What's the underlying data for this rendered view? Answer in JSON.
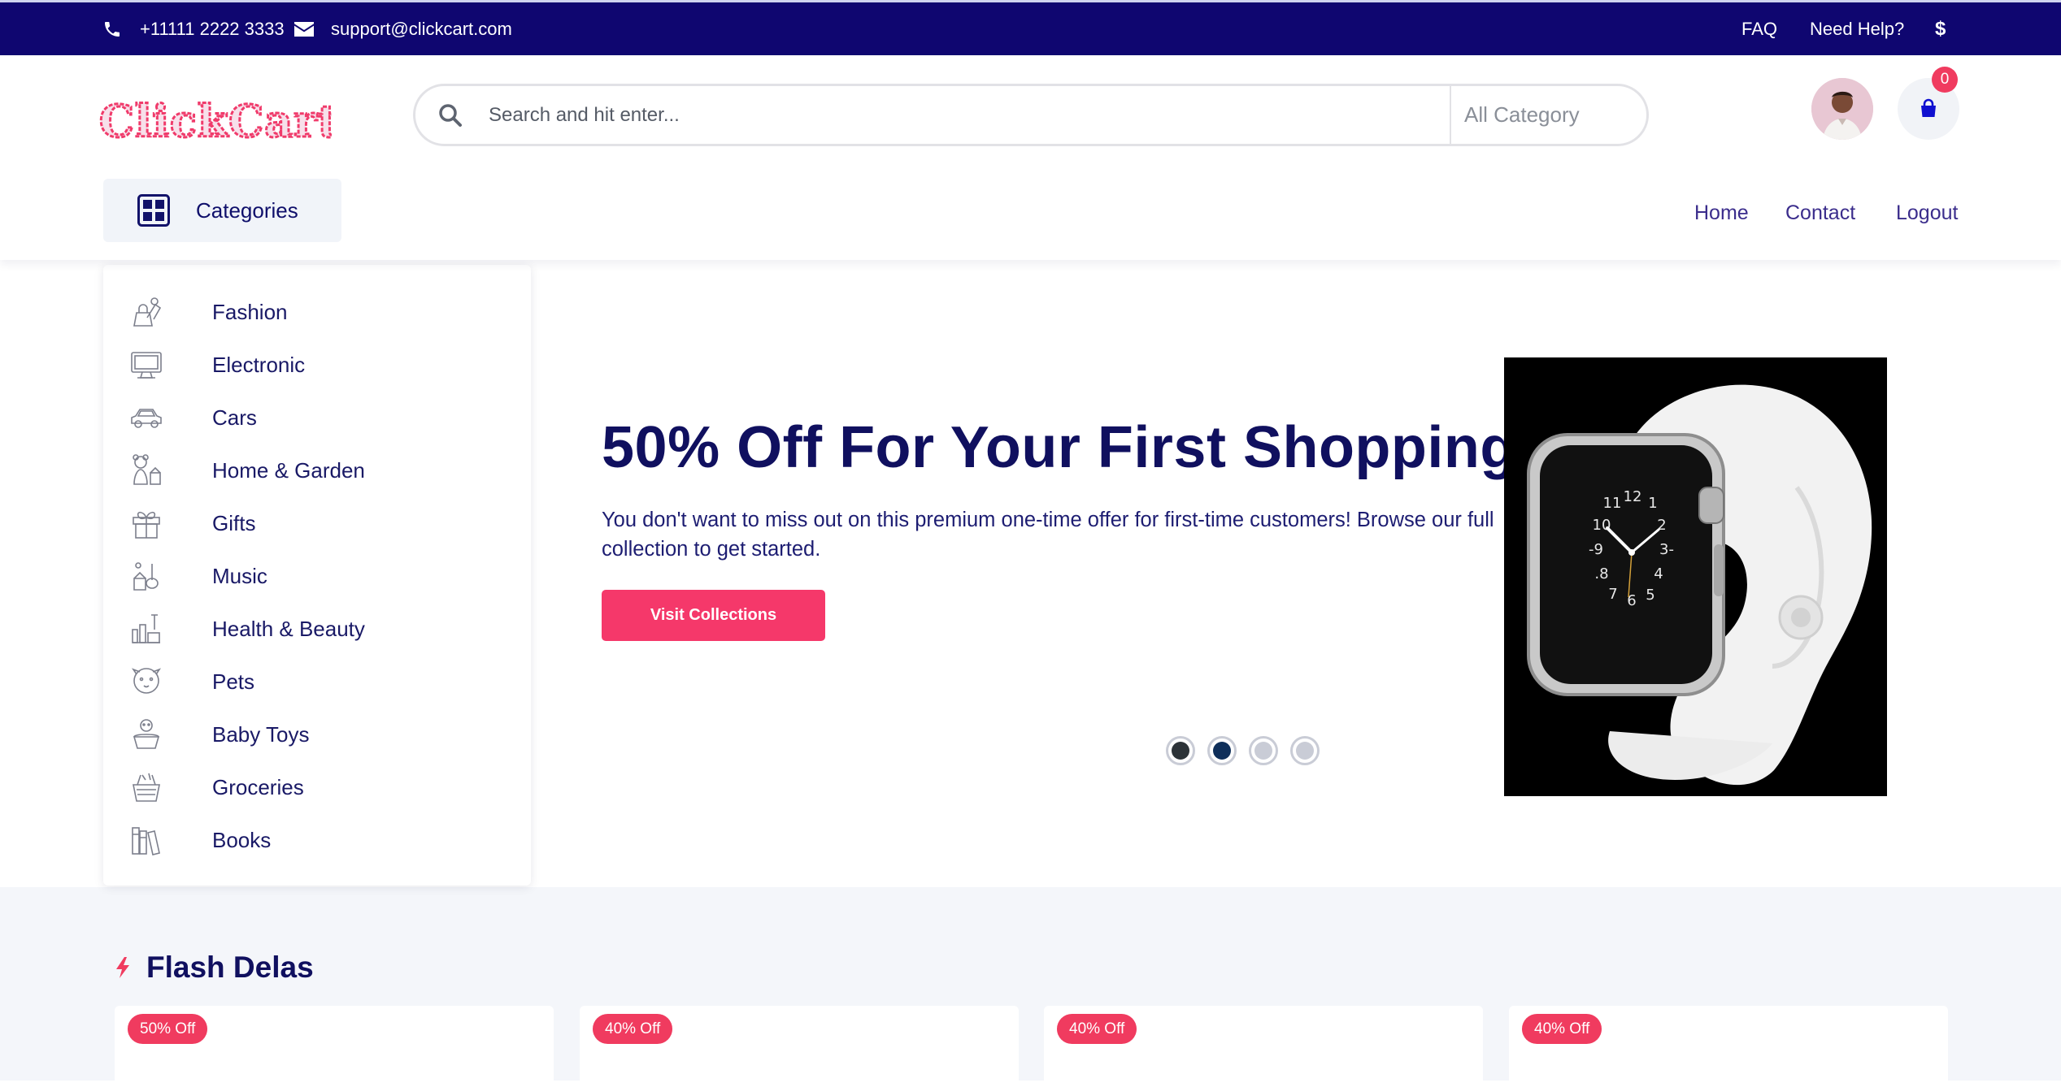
{
  "topbar": {
    "phone": "+11111 2222 3333",
    "email": "support@clickcart.com",
    "faq": "FAQ",
    "help": "Need Help?",
    "currency": "$"
  },
  "brand": {
    "logo_text": "ClickCart",
    "logo_color": "#f03b6b"
  },
  "search": {
    "placeholder": "Search and hit enter...",
    "category": "All Category"
  },
  "cart": {
    "count": "0"
  },
  "categories_button": "Categories",
  "nav": [
    {
      "label": "Home"
    },
    {
      "label": "Contact"
    },
    {
      "label": "Logout"
    }
  ],
  "categories": [
    {
      "label": "Fashion",
      "icon": "fashion-icon"
    },
    {
      "label": "Electronic",
      "icon": "electronic-icon"
    },
    {
      "label": "Cars",
      "icon": "car-icon"
    },
    {
      "label": "Home & Garden",
      "icon": "home-garden-icon"
    },
    {
      "label": "Gifts",
      "icon": "gift-icon"
    },
    {
      "label": "Music",
      "icon": "music-icon"
    },
    {
      "label": "Health & Beauty",
      "icon": "health-beauty-icon"
    },
    {
      "label": "Pets",
      "icon": "pets-icon"
    },
    {
      "label": "Baby Toys",
      "icon": "baby-toys-icon"
    },
    {
      "label": "Groceries",
      "icon": "groceries-icon"
    },
    {
      "label": "Books",
      "icon": "books-icon"
    }
  ],
  "hero": {
    "title": "50% Off For Your First Shopping",
    "description": "You don't want to miss out on this premium one-time offer for first-time customers! Browse our full collection to get started.",
    "button": "Visit Collections",
    "active_slide": 2,
    "slide_count": 4
  },
  "flash": {
    "title": "Flash Delas",
    "cards": [
      {
        "badge": "50% Off"
      },
      {
        "badge": "40% Off"
      },
      {
        "badge": "40% Off"
      },
      {
        "badge": "40% Off"
      }
    ]
  },
  "colors": {
    "primary": "#0f0670",
    "accent": "#f5386a",
    "text": "#10105f"
  }
}
